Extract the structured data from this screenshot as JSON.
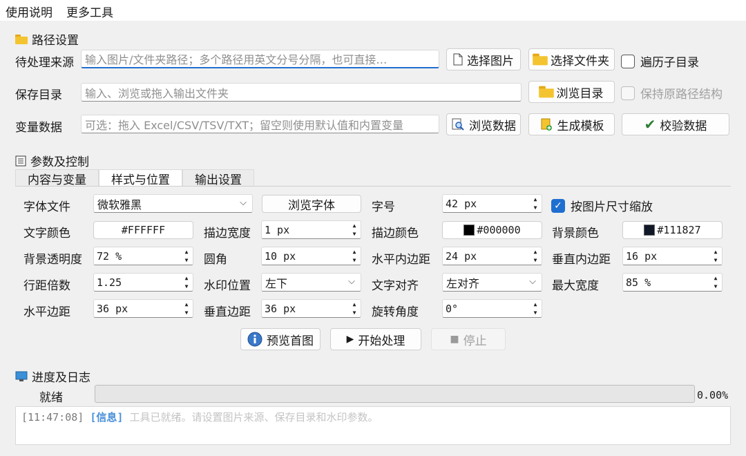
{
  "menu": {
    "help": "使用说明",
    "tools": "更多工具"
  },
  "paths": {
    "title": "路径设置",
    "source_label": "待处理来源",
    "source_placeholder": "输入图片/文件夹路径；多个路径用英文分号分隔，也可直接…",
    "select_images": "选择图片",
    "select_folder": "选择文件夹",
    "recurse": "遍历子目录",
    "output_label": "保存目录",
    "output_placeholder": "输入、浏览或拖入输出文件夹",
    "browse_dir": "浏览目录",
    "keep_structure": "保持原路径结构",
    "vars_label": "变量数据",
    "vars_placeholder": "可选：拖入 Excel/CSV/TSV/TXT；留空则使用默认值和内置变量",
    "browse_data": "浏览数据",
    "gen_template": "生成模板",
    "validate": "校验数据"
  },
  "params": {
    "title": "参数及控制",
    "tabs": [
      "内容与变量",
      "样式与位置",
      "输出设置"
    ],
    "font_file_label": "字体文件",
    "font_file": "微软雅黑",
    "browse_font": "浏览字体",
    "font_size_label": "字号",
    "font_size": "42 px",
    "scale_by_image": "按图片尺寸缩放",
    "text_color_label": "文字颜色",
    "text_color": "#FFFFFF",
    "stroke_width_label": "描边宽度",
    "stroke_width": "1 px",
    "stroke_color_label": "描边颜色",
    "stroke_color": "#000000",
    "bg_color_label": "背景颜色",
    "bg_color": "#111827",
    "bg_opacity_label": "背景透明度",
    "bg_opacity": "72 %",
    "radius_label": "圆角",
    "radius": "10 px",
    "h_padding_label": "水平内边距",
    "h_padding": "24 px",
    "v_padding_label": "垂直内边距",
    "v_padding": "16 px",
    "line_spacing_label": "行距倍数",
    "line_spacing": "1.25",
    "position_label": "水印位置",
    "position": "左下",
    "align_label": "文字对齐",
    "align": "左对齐",
    "max_width_label": "最大宽度",
    "max_width": "85 %",
    "h_margin_label": "水平边距",
    "h_margin": "36 px",
    "v_margin_label": "垂直边距",
    "v_margin": "36 px",
    "rotation_label": "旋转角度",
    "rotation": "0°",
    "preview": "预览首图",
    "start": "开始处理",
    "stop": "停止"
  },
  "progress": {
    "title": "进度及日志",
    "status": "就绪",
    "value": 0,
    "percent": "0.00%",
    "log_time": "[11:47:08]",
    "log_level": "[信息]",
    "log_msg": "工具已就绪。请设置图片来源、保存目录和水印参数。"
  },
  "colors": {
    "accent": "#1f6fd0",
    "text_white": "#FFFFFF",
    "stroke_black": "#000000",
    "bg_dark": "#111827",
    "log_info": "#4a90d9"
  }
}
